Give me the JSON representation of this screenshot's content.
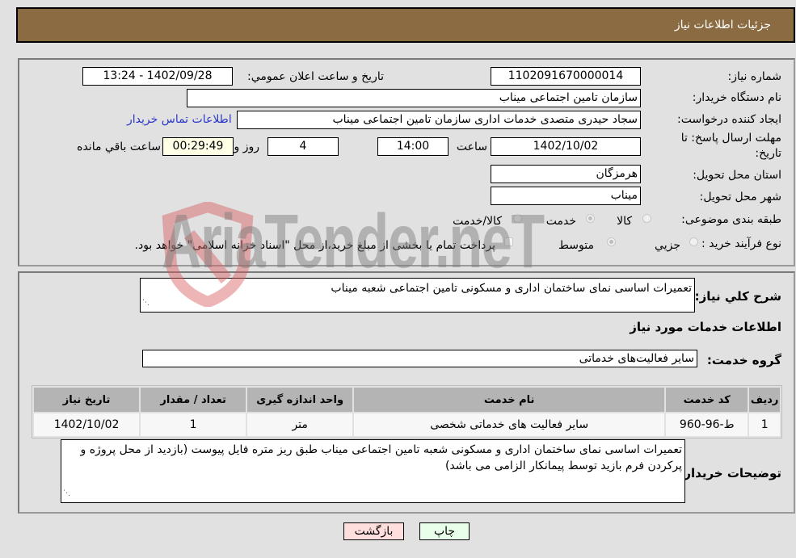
{
  "header": {
    "title": "جزئیات اطلاعات نیاز"
  },
  "details": {
    "need_number_label": "شماره نیاز:",
    "need_number": "1102091670000014",
    "announce_label": "تاریخ و ساعت اعلان عمومي:",
    "announce_value": "1402/09/28 - 13:24",
    "buyer_org_label": "نام دستگاه خریدار:",
    "buyer_org": "سازمان تامین اجتماعی میناب",
    "creator_label": "ایجاد کننده درخواست:",
    "creator": "سجاد حیدری متصدی خدمات اداری سازمان تامین اجتماعی میناب",
    "contact_link": "اطلاعات تماس خریدار",
    "deadline_label_1": "مهلت ارسال پاسخ: تا",
    "deadline_label_2": "تاریخ:",
    "deadline_date": "1402/10/02",
    "time_label": "ساعت",
    "deadline_time": "14:00",
    "days": "4",
    "days_label": "روز و",
    "remaining": "00:29:49",
    "remaining_label": "ساعت باقي مانده",
    "province_label": "استان محل تحویل:",
    "province": "هرمزگان",
    "city_label": "شهر محل تحویل:",
    "city": "میناب",
    "category_label": "طبقه بندی موضوعی:",
    "category_options": [
      "کالا",
      "خدمت",
      "کالا/خدمت"
    ],
    "category_selected": "خدمت",
    "process_label": "نوع فرآیند خرید :",
    "process_options": [
      "جزيي",
      "متوسط"
    ],
    "process_selected": "متوسط",
    "treasury_note": "پرداخت تمام یا بخشی از مبلغ خرید،از محل \"اسناد خزانه اسلامی\" خواهد بود."
  },
  "needs": {
    "summary_label": "شرح كلي نياز:",
    "summary": "تعمیرات اساسی نمای ساختمان اداری و مسکونی تامین اجتماعی شعبه میناب",
    "services_heading": "اطلاعات خدمات مورد نیاز",
    "service_group_label": "گروه خدمت:",
    "service_group": "سایر فعالیت‌های خدماتی",
    "table": {
      "headers": [
        "ردیف",
        "کد خدمت",
        "نام خدمت",
        "واحد اندازه گیری",
        "تعداد / مقدار",
        "تاریخ نیاز"
      ],
      "rows": [
        [
          "1",
          "ط-96-960",
          "سایر فعالیت های خدماتی شخصی",
          "متر",
          "1",
          "1402/10/02"
        ]
      ]
    },
    "buyer_notes_label": "توضیحات خریدار:",
    "buyer_notes": "تعمیرات اساسی نمای ساختمان اداری و مسکونی شعبه تامین اجتماعی میناب طبق ریز متره فایل پیوست  (بازدید از محل پروژه و پرکردن فرم بازید توسط پیمانکار الزامی می باشد)"
  },
  "buttons": {
    "print": "چاپ",
    "back": "بازگشت"
  },
  "watermark": "AriaTender.neT"
}
